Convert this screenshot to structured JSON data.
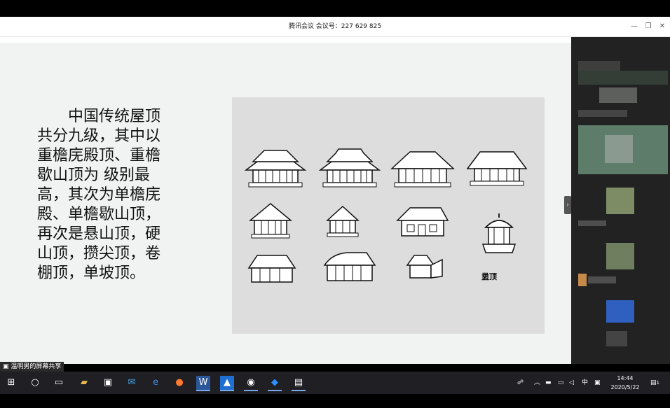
{
  "window": {
    "title": "腾讯会议  会议号：227 629 825",
    "minimize_icon": "minimize-icon",
    "restore_icon": "restore-icon",
    "close_icon": "close-icon"
  },
  "slide": {
    "lines": [
      "　　中国传统屋顶",
      "共分九级，其中以",
      "重檐庑殿顶、重檐",
      "歇山顶为 级别最",
      "高，其次为单檐庑",
      "殿、单檐歇山顶，",
      "再次是悬山顶，硬",
      "山顶，攒尖顶，卷",
      "棚顶，单坡顶。"
    ],
    "figure_caption": "盝顶"
  },
  "share_indicator": {
    "label": "温明男的屏幕共享"
  },
  "taskbar": {
    "input_method": "中",
    "time": "14:44",
    "date": "2020/5/22",
    "notification_count": "1"
  },
  "colors": {
    "taskbar": "#1f1f24",
    "slide_bg": "#f1f3f2",
    "figure_bg": "#dddddd",
    "sidebar": "#222222"
  }
}
